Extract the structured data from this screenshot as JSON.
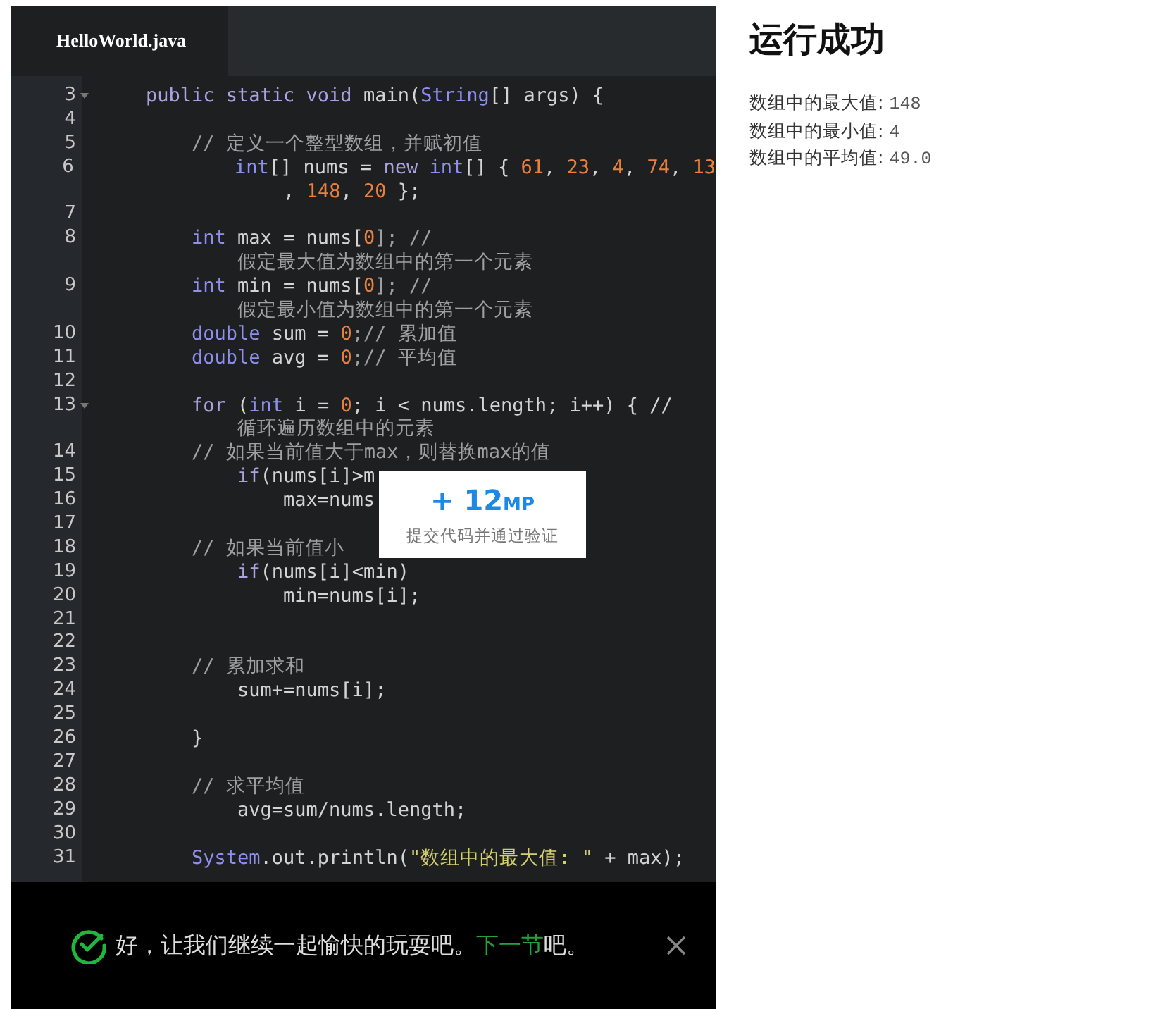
{
  "editor": {
    "tabs": [
      {
        "label": "HelloWorld.java",
        "selected": true
      }
    ],
    "lines": [
      {
        "number": "3",
        "foldable": true,
        "segments": [
          {
            "text": "    public static void",
            "kind": "keyword"
          },
          {
            "text": " main(",
            "kind": "plain"
          },
          {
            "text": "String",
            "kind": "type"
          },
          {
            "text": "[] args) {",
            "kind": "plain"
          }
        ]
      },
      {
        "number": "4"
      },
      {
        "number": "5",
        "segments": [
          {
            "text": "        // 定义一个整型数组，并赋初值",
            "kind": "comment"
          }
        ]
      },
      {
        "number": "6",
        "segments": [
          {
            "text": "            int",
            "kind": "type"
          },
          {
            "text": "[] nums = ",
            "kind": "plain"
          },
          {
            "text": "new",
            "kind": "keyword"
          },
          {
            "text": " int",
            "kind": "type"
          },
          {
            "text": "[] { ",
            "kind": "plain"
          },
          {
            "text": "61",
            "kind": "number"
          },
          {
            "text": ", ",
            "kind": "plain"
          },
          {
            "text": "23",
            "kind": "number"
          },
          {
            "text": ", ",
            "kind": "plain"
          },
          {
            "text": "4",
            "kind": "number"
          },
          {
            "text": ", ",
            "kind": "plain"
          },
          {
            "text": "74",
            "kind": "number"
          },
          {
            "text": ", ",
            "kind": "plain"
          },
          {
            "text": "13",
            "kind": "number"
          }
        ]
      },
      {
        "segments": [
          {
            "text": "                , ",
            "kind": "plain"
          },
          {
            "text": "148",
            "kind": "number"
          },
          {
            "text": ", ",
            "kind": "plain"
          },
          {
            "text": "20",
            "kind": "number"
          },
          {
            "text": " };",
            "kind": "plain"
          }
        ]
      },
      {
        "number": "7"
      },
      {
        "number": "8",
        "segments": [
          {
            "text": "        int",
            "kind": "type"
          },
          {
            "text": " max = nums[",
            "kind": "plain"
          },
          {
            "text": "0",
            "kind": "number"
          },
          {
            "text": "]; //",
            "kind": "comment"
          }
        ]
      },
      {
        "segments": [
          {
            "text": "            假定最大值为数组中的第一个元素",
            "kind": "comment"
          }
        ]
      },
      {
        "number": "9",
        "segments": [
          {
            "text": "        int",
            "kind": "type"
          },
          {
            "text": " min = nums[",
            "kind": "plain"
          },
          {
            "text": "0",
            "kind": "number"
          },
          {
            "text": "]; //",
            "kind": "comment"
          }
        ]
      },
      {
        "segments": [
          {
            "text": "            假定最小值为数组中的第一个元素",
            "kind": "comment"
          }
        ]
      },
      {
        "number": "10",
        "segments": [
          {
            "text": "        double",
            "kind": "type"
          },
          {
            "text": " sum = ",
            "kind": "plain"
          },
          {
            "text": "0",
            "kind": "number"
          },
          {
            "text": ";// 累加值",
            "kind": "comment"
          }
        ]
      },
      {
        "number": "11",
        "segments": [
          {
            "text": "        double",
            "kind": "type"
          },
          {
            "text": " avg = ",
            "kind": "plain"
          },
          {
            "text": "0",
            "kind": "number"
          },
          {
            "text": ";// 平均值",
            "kind": "comment"
          }
        ]
      },
      {
        "number": "12"
      },
      {
        "number": "13",
        "foldable": true,
        "segments": [
          {
            "text": "        for",
            "kind": "keyword"
          },
          {
            "text": " (",
            "kind": "plain"
          },
          {
            "text": "int",
            "kind": "type"
          },
          {
            "text": " i = ",
            "kind": "plain"
          },
          {
            "text": "0",
            "kind": "number"
          },
          {
            "text": "; i < nums.length; i++) { //",
            "kind": "plain"
          }
        ]
      },
      {
        "segments": [
          {
            "text": "            循环遍历数组中的元素",
            "kind": "comment"
          }
        ]
      },
      {
        "number": "14",
        "segments": [
          {
            "text": "        // 如果当前值大于max，则替换max的值",
            "kind": "comment"
          }
        ]
      },
      {
        "number": "15",
        "segments": [
          {
            "text": "            if",
            "kind": "keyword"
          },
          {
            "text": "(nums[i]>m",
            "kind": "plain"
          }
        ]
      },
      {
        "number": "16",
        "segments": [
          {
            "text": "                max=nums",
            "kind": "plain"
          }
        ]
      },
      {
        "number": "17"
      },
      {
        "number": "18",
        "segments": [
          {
            "text": "        // 如果当前值小",
            "kind": "comment"
          }
        ]
      },
      {
        "number": "19",
        "segments": [
          {
            "text": "            if",
            "kind": "keyword"
          },
          {
            "text": "(nums[i]<min)",
            "kind": "plain"
          }
        ]
      },
      {
        "number": "20",
        "segments": [
          {
            "text": "                min=nums[i];",
            "kind": "plain"
          }
        ]
      },
      {
        "number": "21"
      },
      {
        "number": "22"
      },
      {
        "number": "23",
        "segments": [
          {
            "text": "        // 累加求和",
            "kind": "comment"
          }
        ]
      },
      {
        "number": "24",
        "segments": [
          {
            "text": "            sum+=nums[i];",
            "kind": "plain"
          }
        ]
      },
      {
        "number": "25"
      },
      {
        "number": "26",
        "segments": [
          {
            "text": "        }",
            "kind": "plain"
          }
        ]
      },
      {
        "number": "27"
      },
      {
        "number": "28",
        "segments": [
          {
            "text": "        // 求平均值",
            "kind": "comment"
          }
        ]
      },
      {
        "number": "29",
        "segments": [
          {
            "text": "            avg=sum/nums.length;",
            "kind": "plain"
          }
        ]
      },
      {
        "number": "30"
      },
      {
        "number": "31",
        "segments": [
          {
            "text": "        System",
            "kind": "type"
          },
          {
            "text": ".out.println(",
            "kind": "plain"
          },
          {
            "text": "\"数组中的最大值: \"",
            "kind": "string"
          },
          {
            "text": " + max);",
            "kind": "plain"
          }
        ]
      }
    ]
  },
  "reward_popup": {
    "prefix": "+",
    "amount": "12",
    "unit": "MP",
    "caption": "提交代码并通过验证"
  },
  "notice": {
    "text": "好，让我们继续一起愉快的玩耍吧。",
    "link": "下一节",
    "suffix": "吧。"
  },
  "result": {
    "title": "运行成功",
    "output": [
      {
        "label": "数组中的最大值:",
        "value": "148"
      },
      {
        "label": "数组中的最小值:",
        "value": "4"
      },
      {
        "label": "数组中的平均值:",
        "value": "49.0"
      }
    ]
  }
}
